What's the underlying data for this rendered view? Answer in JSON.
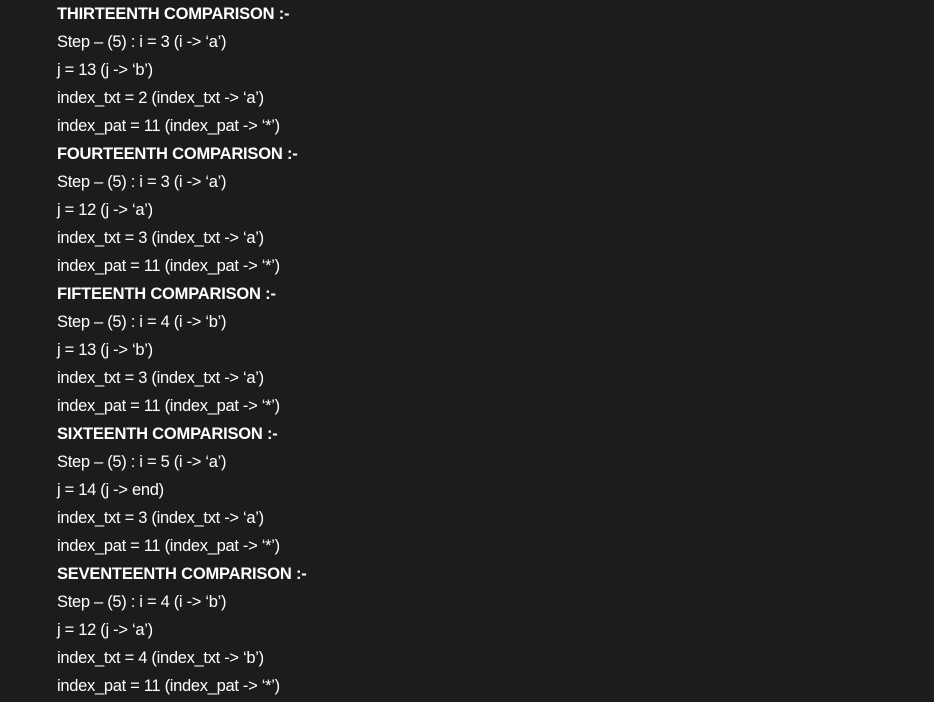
{
  "sections": [
    {
      "heading": "THIRTEENTH COMPARISON :-",
      "lines": [
        "Step – (5) : i = 3 (i -> ‘a’)",
        "j = 13 (j -> ‘b’)",
        "index_txt = 2 (index_txt -> ‘a’)",
        "index_pat = 11 (index_pat -> ‘*’)"
      ]
    },
    {
      "heading": "FOURTEENTH COMPARISON :-",
      "lines": [
        "Step – (5) : i = 3 (i -> ‘a’)",
        "j = 12 (j -> ‘a’)",
        "index_txt = 3 (index_txt -> ‘a’)",
        "index_pat = 11 (index_pat -> ‘*’)"
      ]
    },
    {
      "heading": "FIFTEENTH COMPARISON :-",
      "lines": [
        "Step – (5) : i = 4 (i -> ‘b’)",
        "j = 13 (j -> ‘b’)",
        "index_txt = 3 (index_txt -> ‘a’)",
        "index_pat = 11 (index_pat -> ‘*’)"
      ]
    },
    {
      "heading": "SIXTEENTH COMPARISON :-",
      "lines": [
        "Step – (5) : i = 5 (i -> ‘a’)",
        "j = 14 (j -> end)",
        "index_txt = 3 (index_txt -> ‘a’)",
        "index_pat = 11 (index_pat -> ‘*’)"
      ]
    },
    {
      "heading": "SEVENTEENTH COMPARISON :-",
      "lines": [
        "Step – (5) : i = 4 (i -> ‘b’)",
        "j = 12 (j -> ‘a’)",
        "index_txt = 4 (index_txt -> ‘b’)",
        "index_pat = 11 (index_pat -> ‘*’)"
      ]
    }
  ]
}
